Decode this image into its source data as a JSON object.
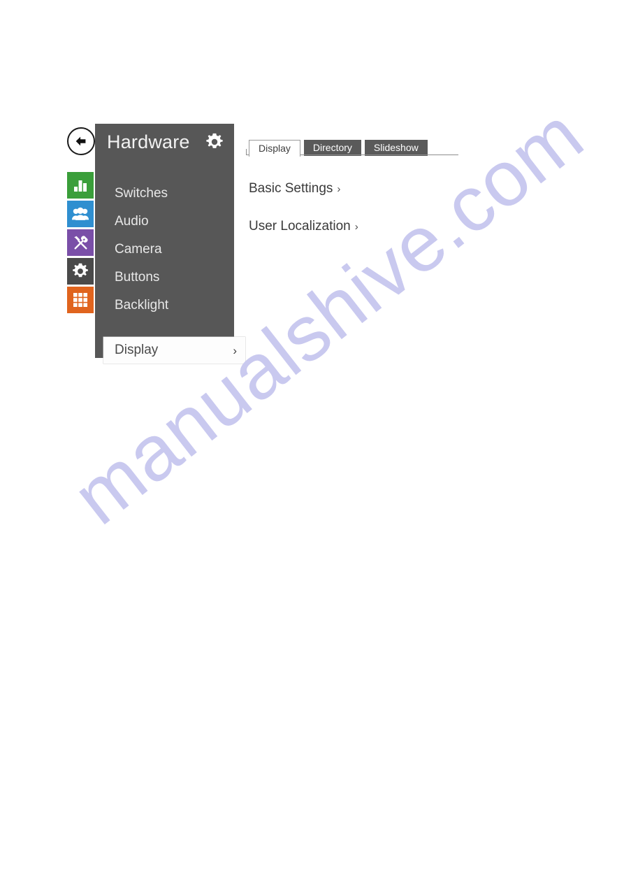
{
  "watermark": {
    "text": "manualshive.com",
    "color": "#c9c9ef"
  },
  "rail": {
    "back_button": {
      "name": "back",
      "icon": "arrow-left-icon"
    },
    "items": [
      {
        "id": "status",
        "icon": "bar-chart-icon",
        "color": "#3a9e3a"
      },
      {
        "id": "directory",
        "icon": "people-icon",
        "color": "#2f8fd0"
      },
      {
        "id": "tools",
        "icon": "tools-icon",
        "color": "#7a4fa8"
      },
      {
        "id": "settings",
        "icon": "gear-icon",
        "color": "#4a4a4a"
      },
      {
        "id": "apps",
        "icon": "grid-icon",
        "color": "#e0641e"
      }
    ]
  },
  "menu": {
    "title": "Hardware",
    "header_icon": "gear-icon",
    "panel_color": "#575757",
    "items": [
      {
        "label": "Switches",
        "active": false
      },
      {
        "label": "Audio",
        "active": false
      },
      {
        "label": "Camera",
        "active": false
      },
      {
        "label": "Buttons",
        "active": false
      },
      {
        "label": "Backlight",
        "active": false
      }
    ],
    "active_item": {
      "label": "Display",
      "chevron": "›"
    }
  },
  "content": {
    "tabs": [
      {
        "label": "Display",
        "active": true
      },
      {
        "label": "Directory",
        "active": false
      },
      {
        "label": "Slideshow",
        "active": false
      }
    ],
    "links": [
      {
        "label": "Basic Settings",
        "chevron": "›"
      },
      {
        "label": "User Localization",
        "chevron": "›"
      }
    ]
  }
}
